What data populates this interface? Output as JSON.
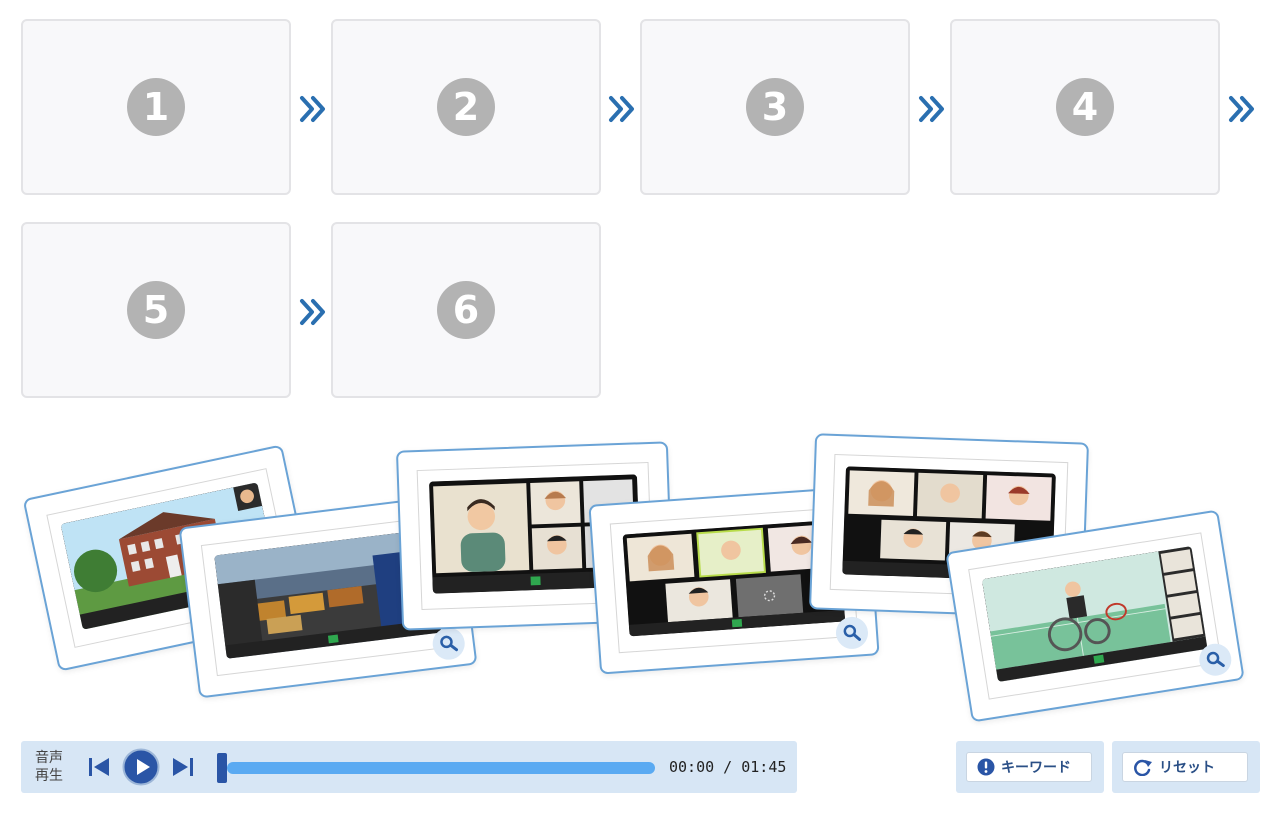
{
  "slots": [
    "1",
    "2",
    "3",
    "4",
    "5",
    "6"
  ],
  "player": {
    "label_line1": "音声",
    "label_line2": "再生",
    "time": "00:00 / 01:45",
    "progress": 0
  },
  "buttons": {
    "keyword": "キーワード",
    "reset": "リセット"
  },
  "cards": [
    {
      "scene": "school-building"
    },
    {
      "scene": "cafeteria-food"
    },
    {
      "scene": "video-call-grid-3"
    },
    {
      "scene": "video-call-grid-5"
    },
    {
      "scene": "video-call-grid-5b"
    },
    {
      "scene": "wheelchair-tennis"
    }
  ],
  "colors": {
    "accent": "#2a6fb0",
    "slot_number": "#b3b3b3",
    "card_border": "#6aa3d6",
    "player_bg": "#d7e6f5",
    "progress": "#5aaaf2"
  }
}
